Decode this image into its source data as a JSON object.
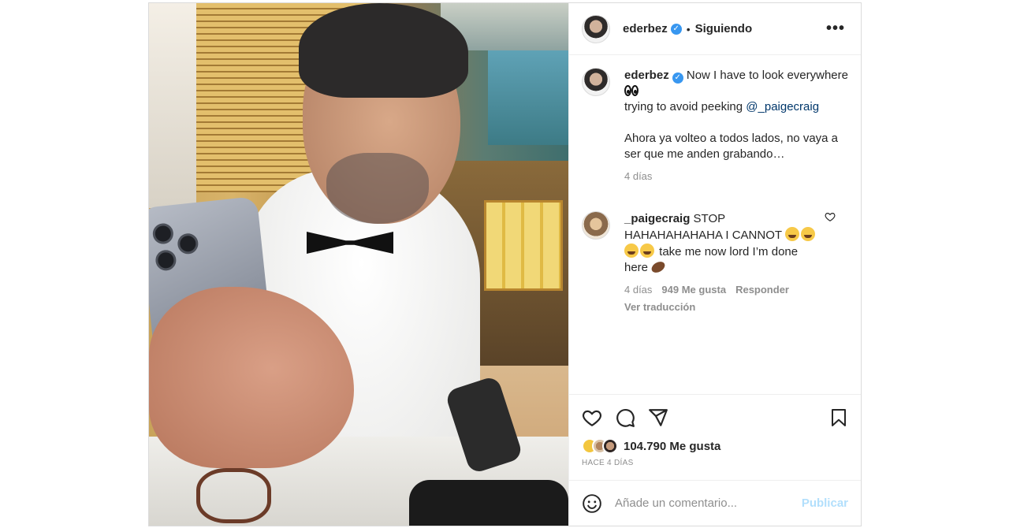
{
  "post": {
    "username": "ederbez",
    "follow_status": "Siguiendo",
    "dot": "•",
    "more_glyph": "•••"
  },
  "caption": {
    "username": "ederbez",
    "line1": "Now I have to look everywhere",
    "line2_prefix": "trying to avoid peeking",
    "mention": "@_paigecraig",
    "line3": "Ahora ya volteo a todos lados, no vaya a ser que me anden grabando…",
    "time": "4 días"
  },
  "comment": {
    "username": "_paigecraig",
    "text_a": "STOP HAHAHAHAHAHA I CANNOT",
    "text_b": "take me now lord I’m done here",
    "time": "4 días",
    "likes": "949 Me gusta",
    "reply": "Responder",
    "translate": "Ver traducción"
  },
  "stats": {
    "likes": "104.790 Me gusta",
    "time_ago": "HACE 4 DÍAS"
  },
  "add_comment": {
    "placeholder": "Añade un comentario...",
    "publish": "Publicar"
  },
  "icons": {
    "verified": "verified-badge-icon",
    "like": "heart-icon",
    "comment": "comment-icon",
    "share": "send-icon",
    "save": "bookmark-icon",
    "emoji": "emoji-icon"
  },
  "colors": {
    "verified": "#3897f0",
    "link": "#00376b",
    "publish_disabled": "#b2dffc",
    "muted": "#8e8e8e"
  }
}
